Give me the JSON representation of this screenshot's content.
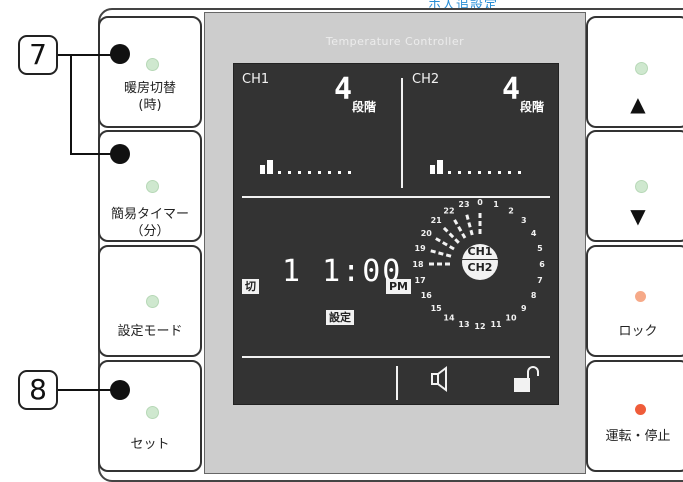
{
  "header": {
    "label": "ホ人追設定"
  },
  "left_buttons": [
    {
      "label": "暖房切替\n(時)"
    },
    {
      "label": "簡易タイマー\n（分）"
    },
    {
      "label": "設定モード"
    },
    {
      "label": "セット"
    }
  ],
  "right_buttons": [
    {
      "label": "▲"
    },
    {
      "label": "▼"
    },
    {
      "label": "ロック"
    },
    {
      "label": "運転・停止"
    }
  ],
  "controller": {
    "title": "Temperature Controller",
    "ch1": {
      "label": "CH1",
      "digit": "4",
      "suffix": "段階",
      "level_bars": 2
    },
    "ch2": {
      "label": "CH2",
      "digit": "4",
      "suffix": "段階",
      "level_bars": 2
    },
    "off_tag": "切",
    "time": "1 1:00",
    "ampm": "PM",
    "setting_tag": "設定",
    "dial": {
      "ch_top": "CH1",
      "ch_bottom": "CH2",
      "hours": [
        "0",
        "1",
        "2",
        "3",
        "4",
        "5",
        "6",
        "7",
        "8",
        "9",
        "10",
        "11",
        "12",
        "13",
        "14",
        "15",
        "16",
        "17",
        "18",
        "19",
        "20",
        "21",
        "22",
        "23"
      ]
    }
  },
  "callouts": {
    "seven": "7",
    "eight": "8"
  }
}
